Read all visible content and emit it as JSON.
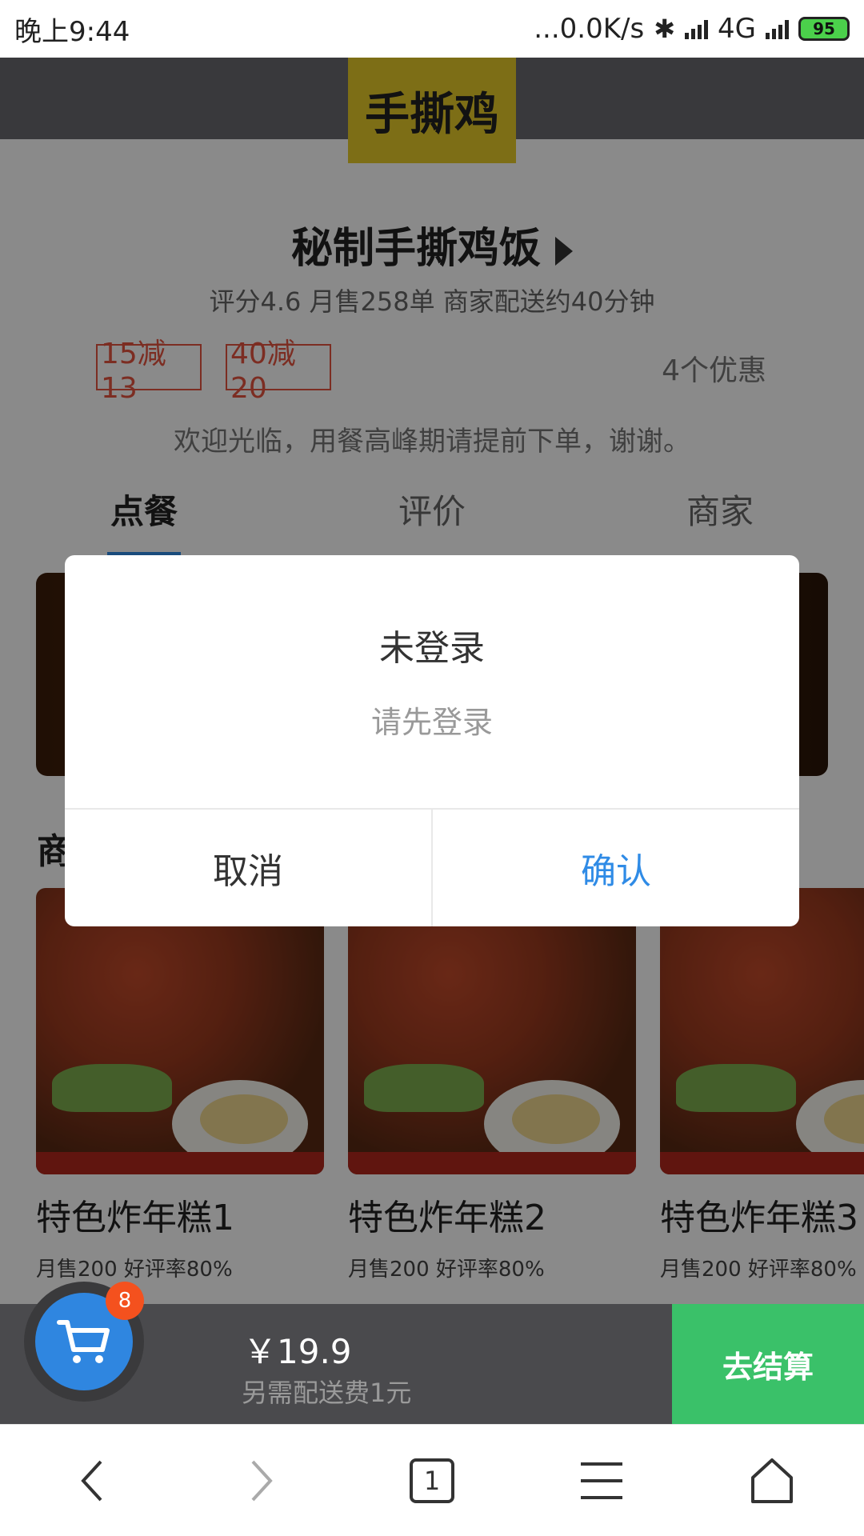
{
  "status_bar": {
    "time": "晚上9:44",
    "network_speed": "...0.0K/s",
    "network_type": "4G",
    "battery_level": "95"
  },
  "shop": {
    "logo_text": "手撕鸡",
    "name": "秘制手撕鸡饭",
    "meta": "评分4.6  月售258单  商家配送约40分钟",
    "promos": [
      "15减13",
      "40减20"
    ],
    "promo_count": "4个优惠",
    "welcome": "欢迎光临，用餐高峰期请提前下单，谢谢。"
  },
  "tabs": [
    {
      "label": "点餐"
    },
    {
      "label": "评价"
    },
    {
      "label": "商家"
    }
  ],
  "section_title": "商",
  "products": [
    {
      "name": "特色炸年糕1",
      "sub": "月售200 好评率80%"
    },
    {
      "name": "特色炸年糕2",
      "sub": "月售200 好评率80%"
    },
    {
      "name": "特色炸年糕3",
      "sub": "月售200 好评率80%"
    }
  ],
  "cart": {
    "badge_count": "8",
    "total_price": "￥19.9",
    "delivery_note": "另需配送费1元",
    "checkout_label": "去结算"
  },
  "dialog": {
    "title": "未登录",
    "message": "请先登录",
    "cancel_label": "取消",
    "confirm_label": "确认"
  },
  "browser_nav": {
    "tab_count": "1",
    "icons": [
      "back-icon",
      "forward-icon",
      "tabs-icon",
      "menu-icon",
      "home-icon"
    ]
  },
  "colors": {
    "accent_blue": "#2f8be6",
    "checkout_green": "#3ac169",
    "promo_red": "#e5533f",
    "badge_orange": "#f4511e"
  }
}
